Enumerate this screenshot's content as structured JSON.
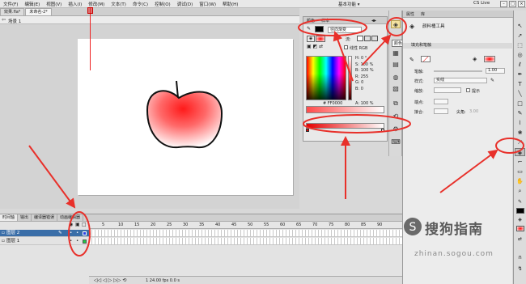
{
  "menubar": {
    "items": [
      "文件(F)",
      "编辑(E)",
      "视图(V)",
      "插入(I)",
      "修改(M)",
      "文本(T)",
      "命令(C)",
      "控制(O)",
      "调试(D)",
      "窗口(W)",
      "帮助(H)"
    ],
    "workspace": "基本功能 ▾",
    "cslive": "CS Live"
  },
  "tabs": [
    "效果.fla*",
    "未命名-2*"
  ],
  "scene": "场景 1",
  "color_panel": {
    "tabs": [
      "颜色",
      "样本"
    ],
    "fill_type": "径向渐变",
    "flow_label": "流:",
    "linear_rgb": "线性 RGB",
    "hsb": [
      "H: 0 °",
      "S: 100 %",
      "B: 100 %",
      "R: 255",
      "G: 0",
      "B: 0"
    ],
    "hex": "# FF0000",
    "alpha": "A: 100 %",
    "colors": {
      "stop1": "#ff0000",
      "stop2": "#ffffff"
    }
  },
  "icon_strip": {
    "tooltip": "颜色"
  },
  "properties": {
    "tabs": [
      "属性",
      "库"
    ],
    "tool_name": "颜料桶工具",
    "section": "填充和笔触",
    "stroke_label": "笔触:",
    "stroke_value": "1.00",
    "style_label": "样式:",
    "style_value": "实线",
    "scale_label": "缩放:",
    "hint_label": "提示",
    "cap_label": "端点:",
    "join_label": "接合:",
    "miter_label": "尖角:",
    "miter_value": "3.00"
  },
  "timeline": {
    "tabs": [
      "时间轴",
      "输出",
      "编译器错误",
      "动画编辑器"
    ],
    "frame_numbers": [
      "5",
      "10",
      "15",
      "20",
      "25",
      "30",
      "35",
      "40",
      "45",
      "50",
      "55",
      "60",
      "65",
      "70",
      "75",
      "80",
      "85",
      "90"
    ],
    "layers": [
      {
        "name": "图层 2",
        "selected": true,
        "color": "#2a3fe0"
      },
      {
        "name": "图层 1",
        "selected": false,
        "color": "#22cc44"
      }
    ],
    "footer": "1   24.00 fps   0.0 s"
  },
  "watermark": {
    "brand": "搜狗指南",
    "url": "zhinan.sogou.com"
  },
  "apple": {
    "fill_center": "#ff1a1a",
    "fill_edge": "#ffffff"
  },
  "annotation_color": "#e8302a"
}
